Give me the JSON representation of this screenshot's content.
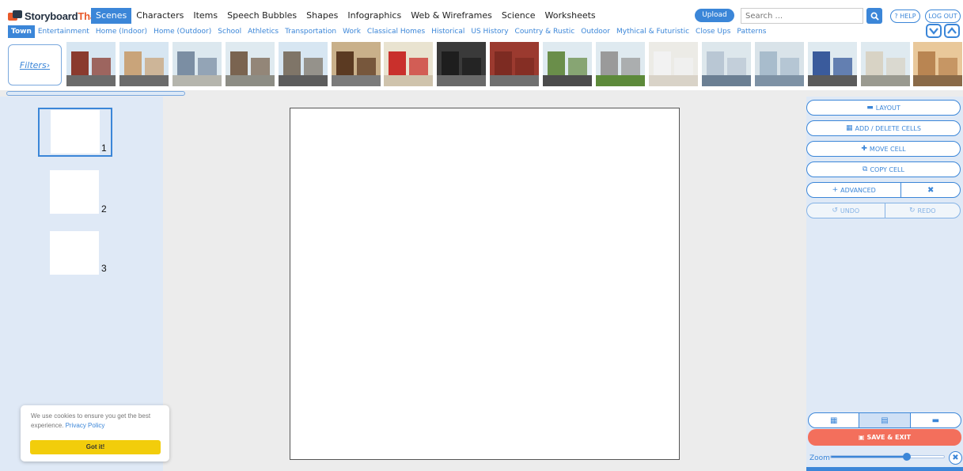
{
  "brand": {
    "name_a": "Storyboard",
    "name_b": "That"
  },
  "main_nav": [
    {
      "label": "Scenes",
      "active": true
    },
    {
      "label": "Characters",
      "active": false
    },
    {
      "label": "Items",
      "active": false
    },
    {
      "label": "Speech Bubbles",
      "active": false
    },
    {
      "label": "Shapes",
      "active": false
    },
    {
      "label": "Infographics",
      "active": false
    },
    {
      "label": "Web & Wireframes",
      "active": false
    },
    {
      "label": "Science",
      "active": false
    },
    {
      "label": "Worksheets",
      "active": false
    }
  ],
  "header": {
    "upload_label": "Upload",
    "search_placeholder": "Search ...",
    "help_label": "? HELP",
    "logout_label": "LOG OUT"
  },
  "categories": [
    {
      "label": "Town",
      "active": true
    },
    {
      "label": "Entertainment",
      "active": false
    },
    {
      "label": "Home (Indoor)",
      "active": false
    },
    {
      "label": "Home (Outdoor)",
      "active": false
    },
    {
      "label": "School",
      "active": false
    },
    {
      "label": "Athletics",
      "active": false
    },
    {
      "label": "Transportation",
      "active": false
    },
    {
      "label": "Work",
      "active": false
    },
    {
      "label": "Classical Homes",
      "active": false
    },
    {
      "label": "Historical",
      "active": false
    },
    {
      "label": "US History",
      "active": false
    },
    {
      "label": "Country & Rustic",
      "active": false
    },
    {
      "label": "Outdoor",
      "active": false
    },
    {
      "label": "Mythical & Futuristic",
      "active": false
    },
    {
      "label": "Close Ups",
      "active": false
    },
    {
      "label": "Patterns",
      "active": false
    }
  ],
  "filters_label": "Filters›",
  "scenes": [
    {
      "name": "town-street-brick",
      "sky": "#d7e6f2",
      "ground": "#6b6b6b",
      "bldg": "#8a3a2e"
    },
    {
      "name": "town-shop-front",
      "sky": "#d7e6f2",
      "ground": "#6b6b6b",
      "bldg": "#c9a47a"
    },
    {
      "name": "city-skyline-plaza",
      "sky": "#dce8ef",
      "ground": "#b5b5ad",
      "bldg": "#7b8ea3"
    },
    {
      "name": "town-park-bench",
      "sky": "#dfeaf0",
      "ground": "#8d8d85",
      "bldg": "#7a6450"
    },
    {
      "name": "town-street-corner",
      "sky": "#d7e6f2",
      "ground": "#5d5d5d",
      "bldg": "#7f7568"
    },
    {
      "name": "building-entrance",
      "sky": "#c9b08a",
      "ground": "#7b7b7b",
      "bldg": "#5b3a22"
    },
    {
      "name": "outdoor-cafe",
      "sky": "#e9e3d0",
      "ground": "#cfc3ac",
      "bldg": "#c9302c"
    },
    {
      "name": "store-window",
      "sky": "#3a3a3a",
      "ground": "#6a6a6a",
      "bldg": "#1e1e1e"
    },
    {
      "name": "red-door-alley",
      "sky": "#9b3a2f",
      "ground": "#707070",
      "bldg": "#7d2b22"
    },
    {
      "name": "parking-lot",
      "sky": "#dfeaf0",
      "ground": "#4c4c4c",
      "bldg": "#6a8e4a"
    },
    {
      "name": "cemetery",
      "sky": "#dfeaf0",
      "ground": "#5d8a3a",
      "bldg": "#9a9a9a"
    },
    {
      "name": "reception-desk",
      "sky": "#ecebe6",
      "ground": "#d9d3c8",
      "bldg": "#f2f2f2"
    },
    {
      "name": "hospital-room",
      "sky": "#dde7ec",
      "ground": "#6b7f93",
      "bldg": "#b9c7d4"
    },
    {
      "name": "hospital-ward",
      "sky": "#d9e3e9",
      "ground": "#7e92a5",
      "bldg": "#a8bccc"
    },
    {
      "name": "blue-bank",
      "sky": "#dfeaf0",
      "ground": "#5b5b5b",
      "bldg": "#3a5b9c"
    },
    {
      "name": "capitol-building",
      "sky": "#dfeaf0",
      "ground": "#9a9a90",
      "bldg": "#d8d3c5"
    },
    {
      "name": "wooden-house",
      "sky": "#e9c89a",
      "ground": "#8a6a48",
      "bldg": "#b98552"
    }
  ],
  "cells": [
    {
      "number": "1",
      "selected": true
    },
    {
      "number": "2",
      "selected": false
    },
    {
      "number": "3",
      "selected": false
    }
  ],
  "right_panel": {
    "layout": "LAYOUT",
    "add_delete": "ADD / DELETE CELLS",
    "move": "MOVE CELL",
    "copy": "COPY CELL",
    "advanced": "ADVANCED",
    "undo": "UNDO",
    "redo": "REDO",
    "save_exit": "SAVE & EXIT",
    "zoom_label": "Zoom",
    "zoom_level": 0.66
  },
  "cookie": {
    "message": "We use cookies to ensure you get the best experience.",
    "policy_link": "Privacy Policy",
    "button": "Got it!"
  },
  "colors": {
    "accent": "#3b86d8",
    "panel_bg": "#dfe9f6",
    "save": "#f36f5c",
    "cookie_button": "#f2cd0b",
    "brand_orange": "#e85a2a"
  }
}
